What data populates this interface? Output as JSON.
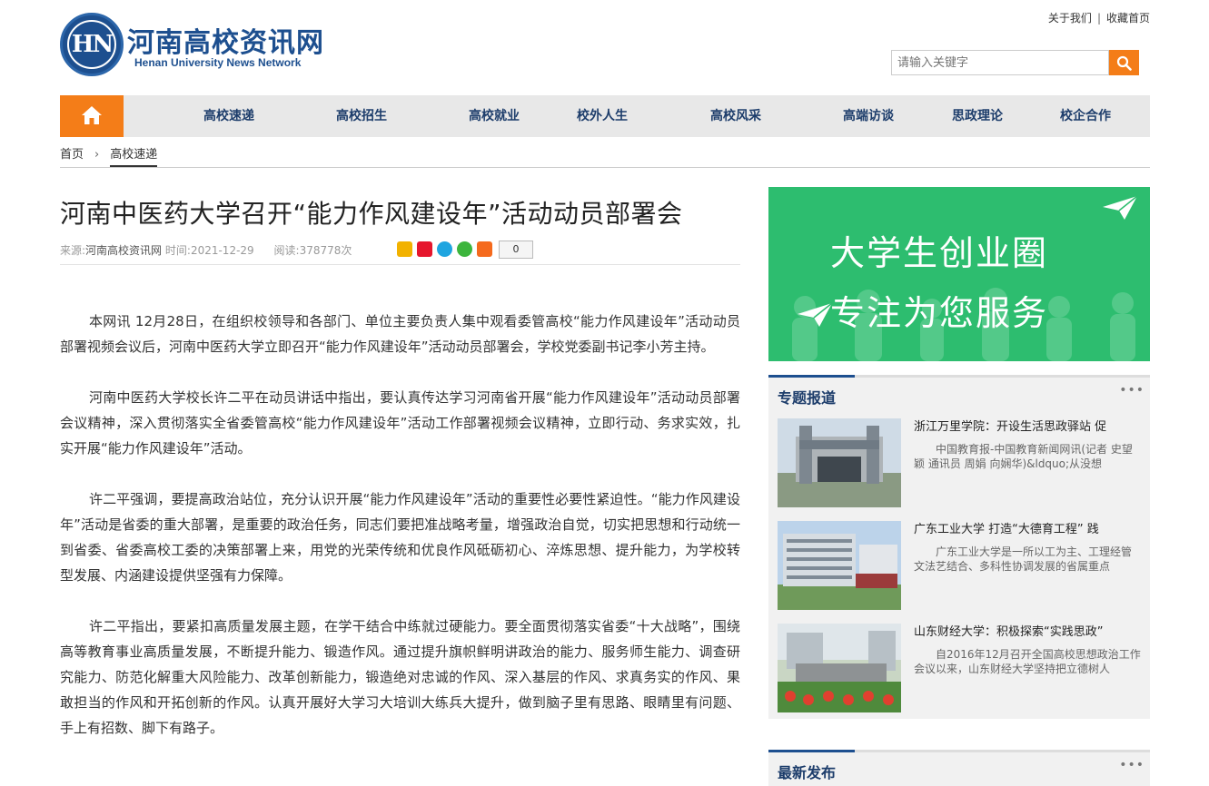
{
  "header": {
    "site_name_cn": "河南高校资讯网",
    "site_name_en": "Henan University News Network",
    "logo_mark": "HN",
    "about_link": "关于我们",
    "separator": "|",
    "favorite_link": "收藏首页",
    "search_placeholder": "请输入关键字"
  },
  "nav": {
    "home_icon": "home-icon",
    "items": [
      "高校速递",
      "高校招生",
      "高校就业",
      "校外人生",
      "高校风采",
      "高端访谈",
      "思政理论",
      "校企合作"
    ]
  },
  "breadcrumb": {
    "home": "首页",
    "current": "高校速递"
  },
  "article": {
    "title": "河南中医药大学召开“能力作风建设年”活动动员部署会",
    "source_label": "来源:",
    "source": "河南高校资讯网",
    "time_label": "时间:",
    "date": "2021-12-29",
    "reads_label": "阅读:",
    "reads": "378778次",
    "share_count": "0",
    "paragraphs": [
      "本网讯 12月28日，在组织校领导和各部门、单位主要负责人集中观看委管高校“能力作风建设年”活动动员部署视频会议后，河南中医药大学立即召开“能力作风建设年”活动动员部署会，学校党委副书记李小芳主持。",
      "河南中医药大学校长许二平在动员讲话中指出，要认真传达学习河南省开展“能力作风建设年”活动动员部署会议精神，深入贯彻落实全省委管高校“能力作风建设年”活动工作部署视频会议精神，立即行动、务求实效，扎实开展“能力作风建设年”活动。",
      "许二平强调，要提高政治站位，充分认识开展“能力作风建设年”活动的重要性必要性紧迫性。“能力作风建设年”活动是省委的重大部署，是重要的政治任务，同志们要把准战略考量，增强政治自觉，切实把思想和行动统一到省委、省委高校工委的决策部署上来，用党的光荣传统和优良作风砥砺初心、淬炼思想、提升能力，为学校转型发展、内涵建设提供坚强有力保障。",
      "许二平指出，要紧扣高质量发展主题，在学干结合中练就过硬能力。要全面贯彻落实省委“十大战略”，围绕高等教育事业高质量发展，不断提升能力、锻造作风。通过提升旗帜鲜明讲政治的能力、服务师生能力、调查研究能力、防范化解重大风险能力、改革创新能力，锻造绝对忠诚的作风、深入基层的作风、求真务实的作风、果敢担当的作风和开拓创新的作风。认真开展好大学习大培训大练兵大提升，做到脑子里有思路、眼睛里有问题、手上有招数、脚下有路子。"
    ]
  },
  "sidebar": {
    "banner_line1": "大学生创业圈",
    "banner_line2": "专注为您服务",
    "topics_heading": "专题报道",
    "more": "•••",
    "topics": [
      {
        "title": "浙江万里学院：开设生活思政驿站 促",
        "desc": "中国教育报-中国教育新闻网讯(记者 史望颖 通讯员 周娟 向娴华)&ldquo;从没想"
      },
      {
        "title": "广东工业大学 打造“大德育工程” 践",
        "desc": "广东工业大学是一所以工为主、工理经管文法艺结合、多科性协调发展的省属重点"
      },
      {
        "title": "山东财经大学：积极探索“实践思政”",
        "desc": "自2016年12月召开全国高校思想政治工作会议以来，山东财经大学坚持把立德树人"
      }
    ],
    "latest_heading": "最新发布"
  },
  "colors": {
    "brand_blue": "#1d4f8f",
    "accent_orange": "#f47d18",
    "banner_green": "#2dbd6f"
  }
}
